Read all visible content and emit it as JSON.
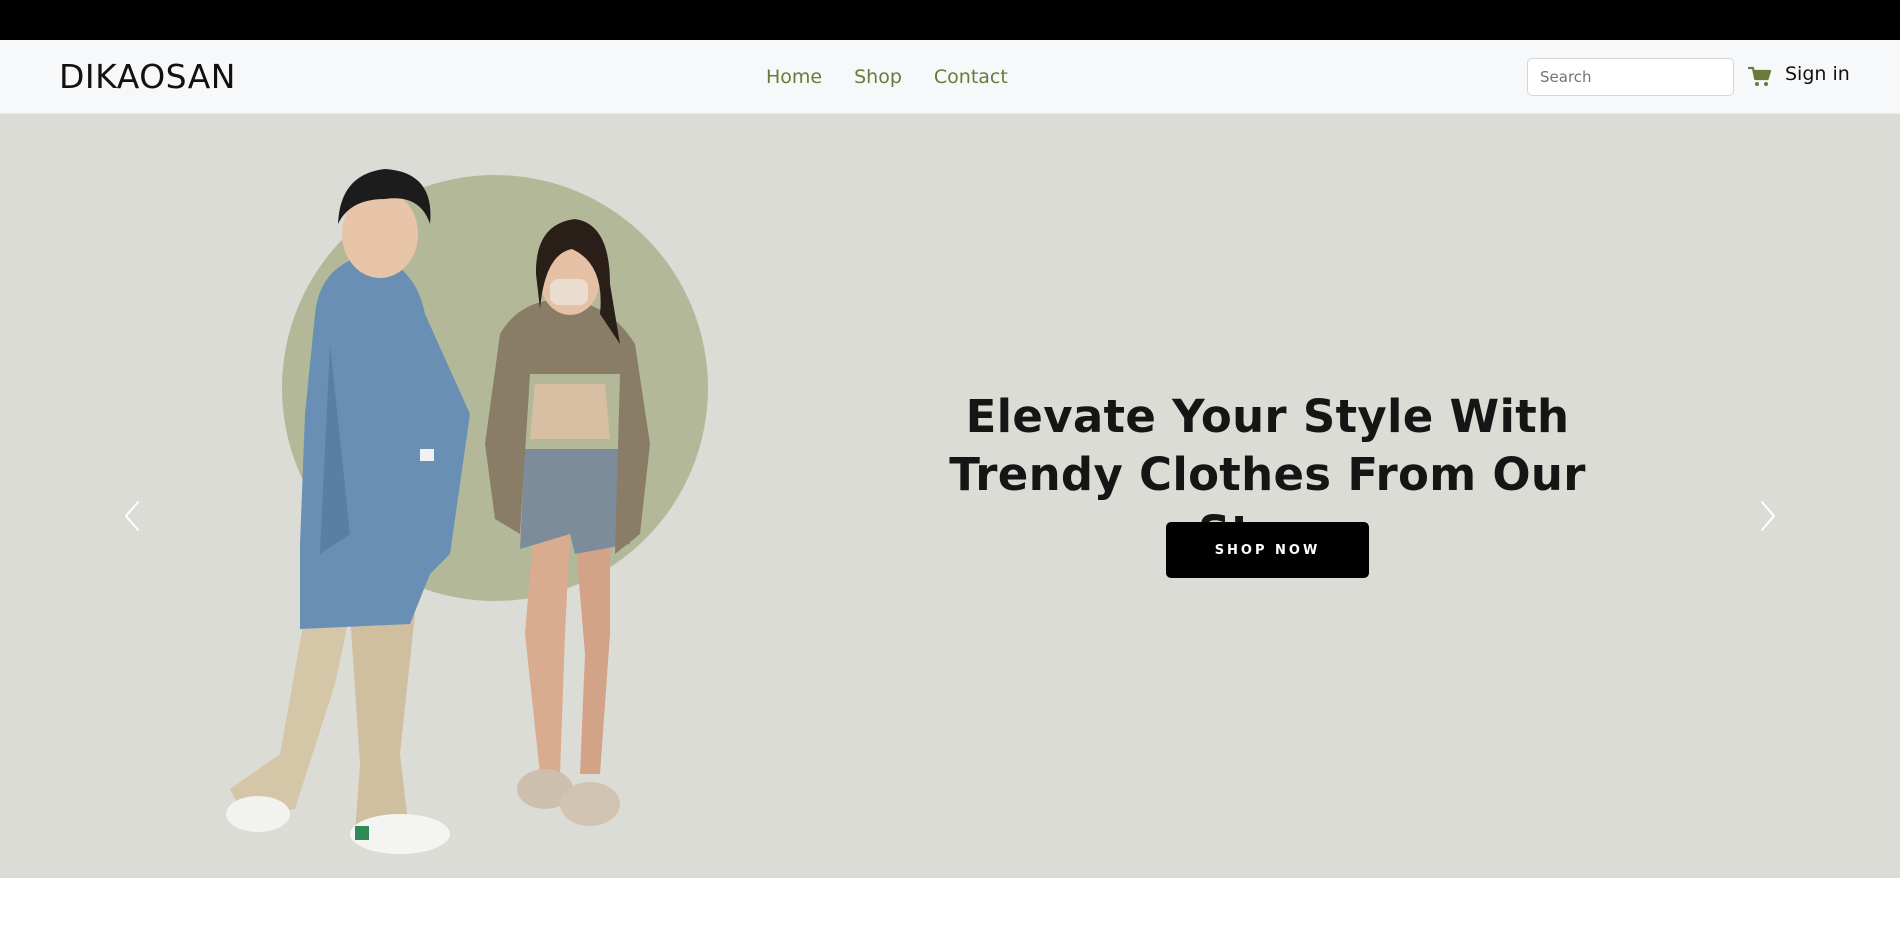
{
  "brand": "DIKAOSAN",
  "nav": {
    "items": [
      "Home",
      "Shop",
      "Contact"
    ]
  },
  "header": {
    "search_placeholder": "Search",
    "cart_icon": "shopping-cart-icon",
    "signin_label": "Sign in"
  },
  "hero": {
    "headline": "Elevate Your Style With Trendy Clothes From Our Store",
    "cta_label": "SHOP NOW",
    "prev_icon": "chevron-left-icon",
    "next_icon": "chevron-right-icon"
  },
  "colors": {
    "topbar": "#000000",
    "navbar_bg": "#f7f8f9",
    "nav_link": "#6b7a3a",
    "hero_bg": "#dcdcd6",
    "hero_circle": "#b3b998",
    "cta_bg": "#000000",
    "cta_text": "#ffffff"
  }
}
